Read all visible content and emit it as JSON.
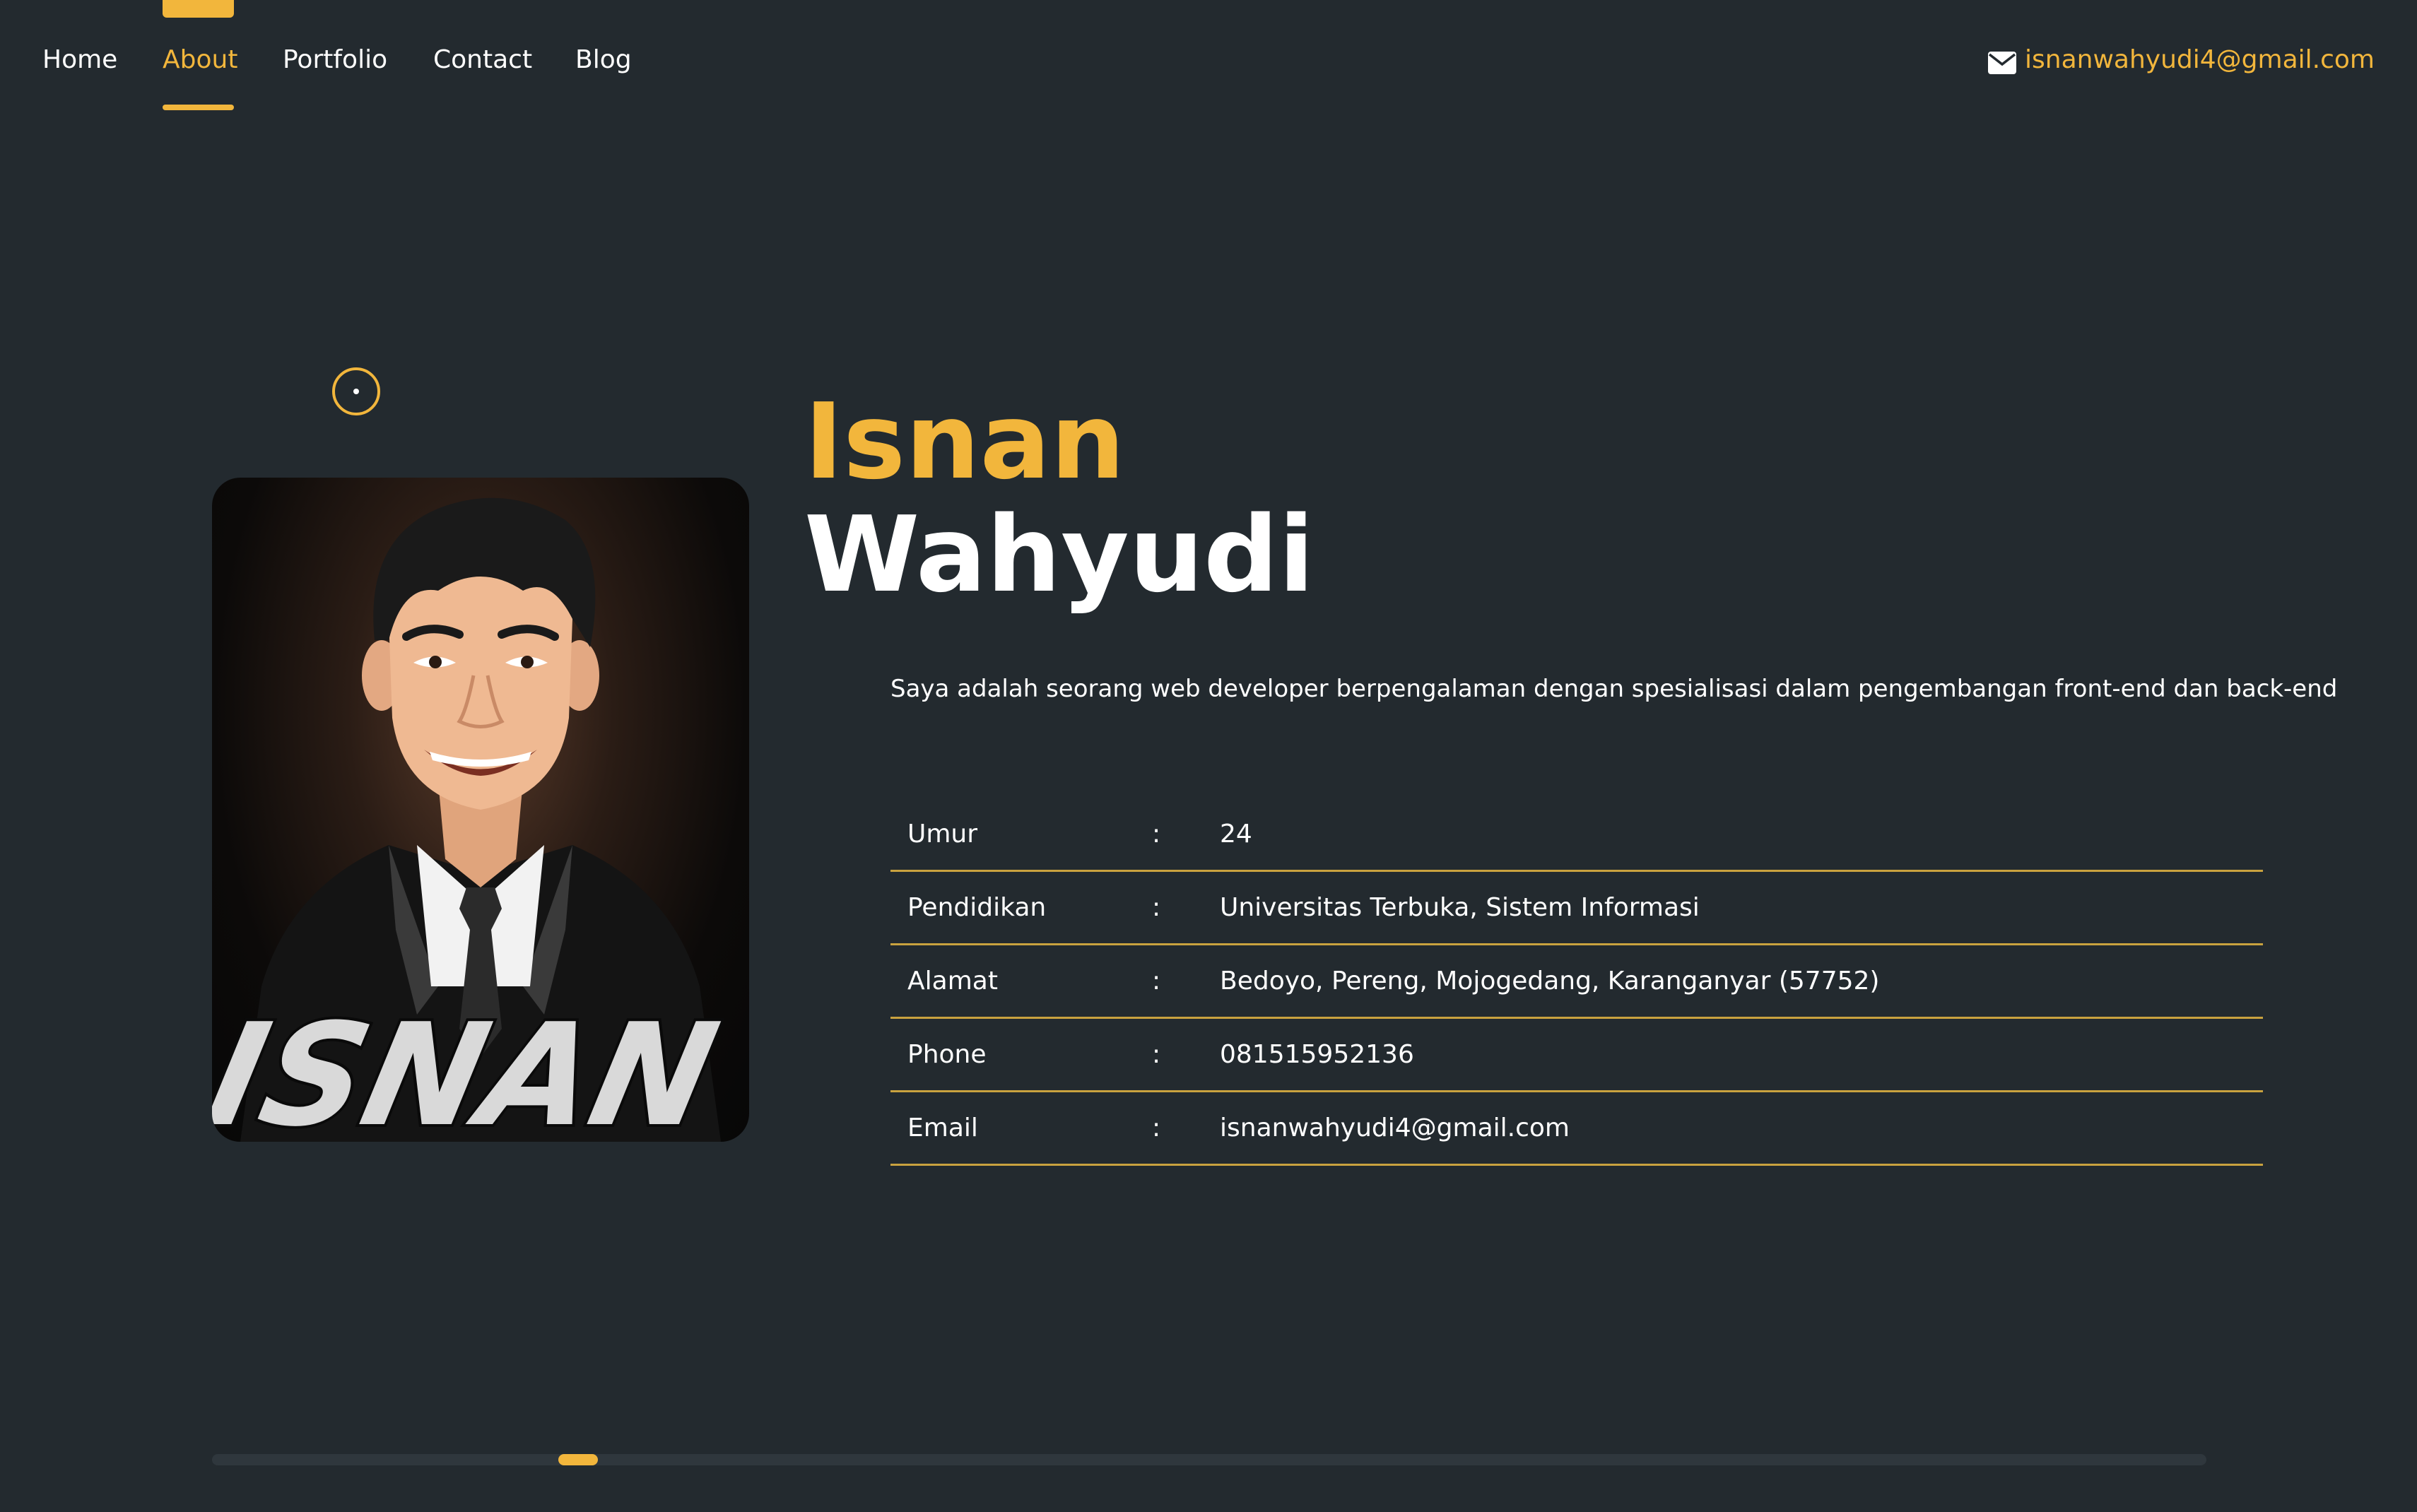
{
  "nav": {
    "items": [
      {
        "label": "Home",
        "active": false
      },
      {
        "label": "About",
        "active": true
      },
      {
        "label": "Portfolio",
        "active": false
      },
      {
        "label": "Contact",
        "active": false
      },
      {
        "label": "Blog",
        "active": false
      }
    ],
    "email": "isnanwahyudi4@gmail.com"
  },
  "profile": {
    "first_name": "Isnan",
    "last_name": "Wahyudi",
    "intro": "Saya adalah seorang web developer berpengalaman dengan spesialisasi dalam pengembangan front-end dan back-end",
    "avatar_caption": "ISNAN W"
  },
  "info": {
    "separator": ":",
    "rows": [
      {
        "label": "Umur",
        "value": "24"
      },
      {
        "label": "Pendidikan",
        "value": "Universitas Terbuka, Sistem Informasi"
      },
      {
        "label": "Alamat",
        "value": "Bedoyo, Pereng, Mojogedang, Karanganyar (57752)"
      },
      {
        "label": "Phone",
        "value": "081515952136"
      },
      {
        "label": "Email",
        "value": "isnanwahyudi4@gmail.com"
      }
    ]
  },
  "scrollbar": {
    "position": 0.18
  },
  "colors": {
    "accent": "#f2b63c",
    "background": "#232a2f",
    "divider": "#c9a23f"
  },
  "icons": {
    "email": "envelope-icon",
    "decor": "target-icon"
  }
}
